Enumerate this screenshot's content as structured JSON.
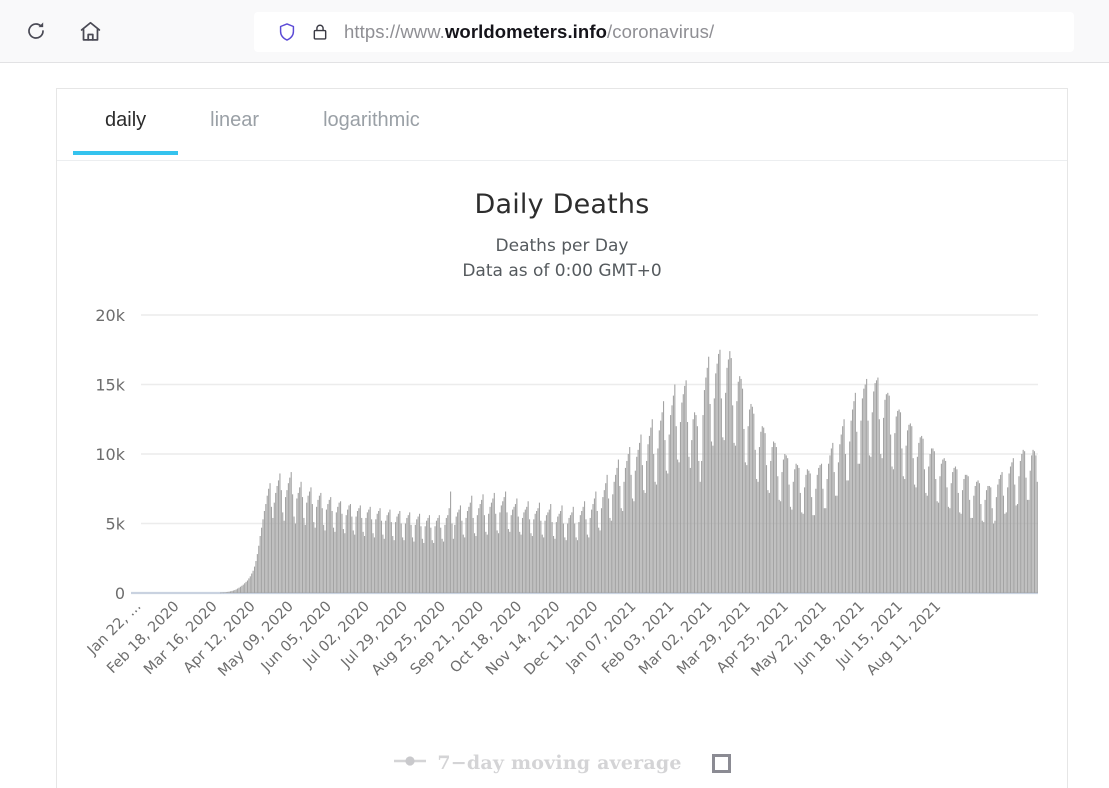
{
  "browser": {
    "reload_icon": "reload-icon",
    "home_icon": "home-icon",
    "shield_icon": "shield-icon",
    "lock_icon": "lock-icon",
    "url_prefix": "https://www.",
    "url_host": "worldometers.info",
    "url_path": "/coronavirus/"
  },
  "tabs": [
    {
      "label": "daily",
      "active": true
    },
    {
      "label": "linear",
      "active": false
    },
    {
      "label": "logarithmic",
      "active": false
    }
  ],
  "chart_header": {
    "title": "Daily Deaths",
    "subtitle_line1": "Deaths per Day",
    "subtitle_line2": "Data as of 0:00 GMT+0"
  },
  "legend": {
    "series_label": "7−day moving average",
    "marker_icon": "line-dot-marker-icon",
    "checkbox_icon": "checkbox-unchecked-icon",
    "checked": false
  },
  "colors": {
    "accent": "#35c3ee",
    "bar": "#a3a3a3",
    "gridline": "#ececec",
    "axis_text": "#6d6d6d",
    "baseline": "#c9d2e0"
  },
  "chart_data": {
    "type": "bar",
    "title": "Daily Deaths",
    "subtitle": "Deaths per Day / Data as of 0:00 GMT+0",
    "xlabel": "",
    "ylabel": "",
    "ylim": [
      0,
      20000
    ],
    "yticks": [
      0,
      5000,
      10000,
      15000,
      20000
    ],
    "ytick_labels": [
      "0",
      "5k",
      "10k",
      "15k",
      "20k"
    ],
    "grid": true,
    "legend_position": "bottom",
    "series_name": "Daily Deaths",
    "xtick_labels": [
      "Jan 22, ...",
      "Feb 18, 2020",
      "Mar 16, 2020",
      "Apr 12, 2020",
      "May 09, 2020",
      "Jun 05, 2020",
      "Jul 02, 2020",
      "Jul 29, 2020",
      "Aug 25, 2020",
      "Sep 21, 2020",
      "Oct 18, 2020",
      "Nov 14, 2020",
      "Dec 11, 2020",
      "Jan 07, 2021",
      "Feb 03, 2021",
      "Mar 02, 2021",
      "Mar 29, 2021",
      "Apr 25, 2021",
      "May 22, 2021",
      "Jun 18, 2021",
      "Jul 15, 2021",
      "Aug 11, 2021"
    ],
    "xtick_every_n_days": 27,
    "x_start_date": "Jan 22, 2020",
    "x_end_date": "Aug 2021",
    "n_points": 580,
    "values": [
      0,
      0,
      0,
      0,
      0,
      0,
      0,
      0,
      0,
      0,
      0,
      0,
      0,
      0,
      0,
      0,
      0,
      0,
      0,
      0,
      0,
      0,
      0,
      0,
      0,
      0,
      0,
      0,
      0,
      0,
      0,
      0,
      0,
      0,
      0,
      0,
      0,
      0,
      0,
      0,
      0,
      0,
      0,
      0,
      0,
      0,
      0,
      0,
      0,
      0,
      0,
      0,
      0,
      0,
      0,
      0,
      30,
      40,
      35,
      50,
      60,
      80,
      100,
      120,
      150,
      180,
      210,
      260,
      320,
      380,
      450,
      520,
      600,
      700,
      800,
      900,
      1050,
      1200,
      1400,
      1600,
      1900,
      2300,
      2800,
      3400,
      4100,
      4700,
      5300,
      5900,
      6400,
      7000,
      7500,
      7900,
      6200,
      5400,
      6500,
      7200,
      7700,
      8100,
      8600,
      7400,
      5800,
      5200,
      6900,
      7400,
      7900,
      8300,
      8700,
      7100,
      5500,
      5000,
      6800,
      7200,
      7600,
      8000,
      6900,
      5400,
      4900,
      6500,
      7000,
      7300,
      7600,
      6400,
      5100,
      4700,
      6200,
      6700,
      7000,
      7200,
      6100,
      4900,
      4500,
      6000,
      6400,
      6700,
      6900,
      5900,
      4700,
      4400,
      5800,
      6200,
      6500,
      6600,
      5700,
      4600,
      4300,
      5600,
      6000,
      6300,
      6400,
      5500,
      4500,
      4200,
      5500,
      5900,
      6100,
      6300,
      5400,
      4400,
      4100,
      5400,
      5800,
      6000,
      6200,
      5300,
      4300,
      4000,
      5300,
      5700,
      5900,
      6100,
      5200,
      4200,
      3900,
      5200,
      5600,
      5800,
      6000,
      5100,
      4100,
      3800,
      5100,
      5500,
      5700,
      5900,
      5000,
      4000,
      3800,
      5000,
      5400,
      5600,
      5800,
      4900,
      4000,
      3700,
      4900,
      5300,
      5500,
      5700,
      4800,
      3900,
      3600,
      4800,
      5200,
      5400,
      5600,
      4700,
      3800,
      3600,
      4800,
      5200,
      5400,
      5600,
      4700,
      3900,
      3700,
      4900,
      5400,
      5600,
      6100,
      7300,
      5000,
      3900,
      4900,
      5500,
      5800,
      6000,
      6300,
      5200,
      4200,
      4000,
      5400,
      5900,
      6200,
      6500,
      7000,
      5400,
      4300,
      4100,
      5600,
      6100,
      6400,
      6700,
      7100,
      5600,
      4400,
      4200,
      5700,
      6200,
      6500,
      6800,
      7200,
      5700,
      4500,
      4300,
      5800,
      6300,
      6600,
      6900,
      7300,
      5800,
      4600,
      4400,
      5600,
      6000,
      6200,
      6400,
      6800,
      5500,
      4400,
      4200,
      5400,
      5800,
      6000,
      6200,
      6600,
      5300,
      4300,
      4100,
      5300,
      5700,
      5900,
      6100,
      6500,
      5200,
      4200,
      4000,
      5200,
      5600,
      5800,
      6000,
      6400,
      5100,
      4100,
      3900,
      5100,
      5500,
      5700,
      5900,
      6300,
      5000,
      4000,
      3800,
      5000,
      5400,
      5600,
      5800,
      6200,
      5000,
      4000,
      3800,
      5100,
      5600,
      5900,
      6200,
      6600,
      5300,
      4200,
      4000,
      5400,
      6000,
      6400,
      6800,
      7300,
      5900,
      4700,
      4500,
      6100,
      6900,
      7400,
      7900,
      8500,
      6800,
      5400,
      5200,
      7100,
      8000,
      8500,
      9000,
      9600,
      7700,
      6100,
      5900,
      8000,
      9000,
      9500,
      10000,
      10500,
      8500,
      6800,
      6600,
      8800,
      9800,
      10300,
      10800,
      11400,
      9200,
      7400,
      7200,
      9500,
      10700,
      11300,
      11900,
      12500,
      10000,
      8000,
      7800,
      10400,
      11700,
      12400,
      13000,
      13800,
      11000,
      8800,
      8600,
      11400,
      12800,
      13500,
      14200,
      15000,
      12000,
      9600,
      9400,
      12300,
      13700,
      14300,
      14900,
      15300,
      12300,
      9800,
      9000,
      11000,
      12500,
      13000,
      12800,
      12000,
      9500,
      8000,
      9500,
      12800,
      14600,
      15500,
      16200,
      17000,
      13600,
      10900,
      10600,
      14000,
      15800,
      16500,
      17200,
      17500,
      14000,
      11200,
      11000,
      14400,
      16200,
      16800,
      17400,
      16900,
      13500,
      10800,
      10600,
      13800,
      15200,
      15600,
      15400,
      14700,
      11800,
      9400,
      9200,
      12000,
      13200,
      13600,
      13400,
      12900,
      10300,
      8200,
      8000,
      10500,
      11600,
      12000,
      11900,
      11500,
      9200,
      7400,
      7200,
      9500,
      10500,
      10900,
      10800,
      10500,
      8400,
      6700,
      6600,
      8700,
      9600,
      10000,
      9900,
      9700,
      7800,
      6200,
      6000,
      8000,
      8900,
      9300,
      9200,
      9000,
      7200,
      5800,
      5700,
      7600,
      8500,
      8900,
      8800,
      8600,
      6900,
      5600,
      5600,
      7500,
      8500,
      9000,
      9200,
      9300,
      7500,
      6100,
      6100,
      8200,
      9300,
      9900,
      10400,
      10800,
      8700,
      7000,
      7000,
      9400,
      10700,
      11400,
      12000,
      12500,
      10000,
      8100,
      8100,
      10900,
      12400,
      13200,
      13800,
      14400,
      11600,
      9300,
      9300,
      12400,
      14000,
      14700,
      15000,
      15400,
      12400,
      9900,
      9800,
      13000,
      14500,
      15100,
      15300,
      15500,
      12500,
      10000,
      9700,
      12600,
      13900,
      14300,
      14400,
      14200,
      11400,
      9100,
      8900,
      11500,
      12700,
      13100,
      13200,
      13000,
      10400,
      8400,
      8200,
      10600,
      11700,
      12100,
      12200,
      12000,
      9700,
      7800,
      7600,
      9800,
      10800,
      11200,
      11300,
      11100,
      8900,
      7200,
      7000,
      9100,
      10000,
      10400,
      10400,
      10200,
      8200,
      6600,
      6500,
      8400,
      9300,
      9600,
      9700,
      9500,
      7600,
      6200,
      6100,
      7900,
      8700,
      9000,
      9100,
      8900,
      7200,
      5800,
      5700,
      7400,
      8200,
      8500,
      8500,
      8400,
      6700,
      5400,
      5400,
      7000,
      7700,
      8000,
      8100,
      7900,
      6400,
      5200,
      5100,
      6700,
      7400,
      7700,
      7700,
      7600,
      6100,
      5000,
      5200,
      6900,
      7800,
      8200,
      8500,
      8700,
      7000,
      5700,
      5800,
      7600,
      8600,
      9100,
      9400,
      9700,
      7800,
      6300,
      6400,
      8400,
      9500,
      10000,
      10300,
      10200,
      8300,
      6700,
      6700,
      8800,
      9900,
      10300,
      10200,
      9900,
      8000
    ]
  }
}
